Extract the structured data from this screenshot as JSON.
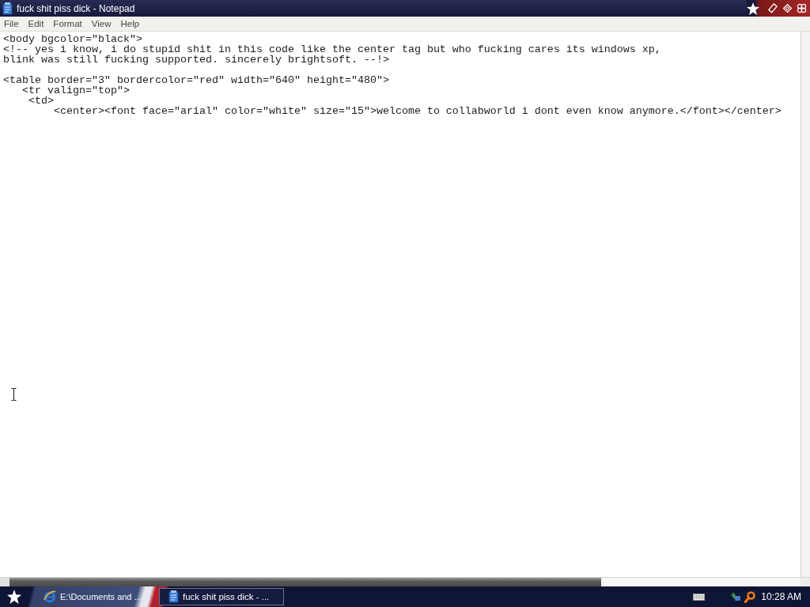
{
  "window": {
    "title": "fuck shit piss dick - Notepad"
  },
  "menu": [
    "File",
    "Edit",
    "Format",
    "View",
    "Help"
  ],
  "editor": {
    "blocks": [
      [
        "<body bgcolor=\"black\">",
        "<!-- yes i know, i do stupid shit in this code like the center tag but who fucking cares its windows xp,",
        "blink was still fucking supported. sincerely brightsoft. --!>"
      ],
      [
        "<table border=\"3\" bordercolor=\"red\" width=\"640\" height=\"480\">",
        "   <tr valign=\"top\">",
        "    <td>",
        "        <center><font face=\"arial\" color=\"white\" size=\"15\">welcome to collabworld i dont even know anymore.</font></center>"
      ]
    ]
  },
  "taskbar": {
    "buttons": [
      {
        "kind": "browser",
        "label": "E:\\Documents and ...",
        "selected": false
      },
      {
        "kind": "notepad",
        "label": "fuck shit piss dick - ...",
        "selected": true
      }
    ],
    "clock": "10:28 AM"
  }
}
